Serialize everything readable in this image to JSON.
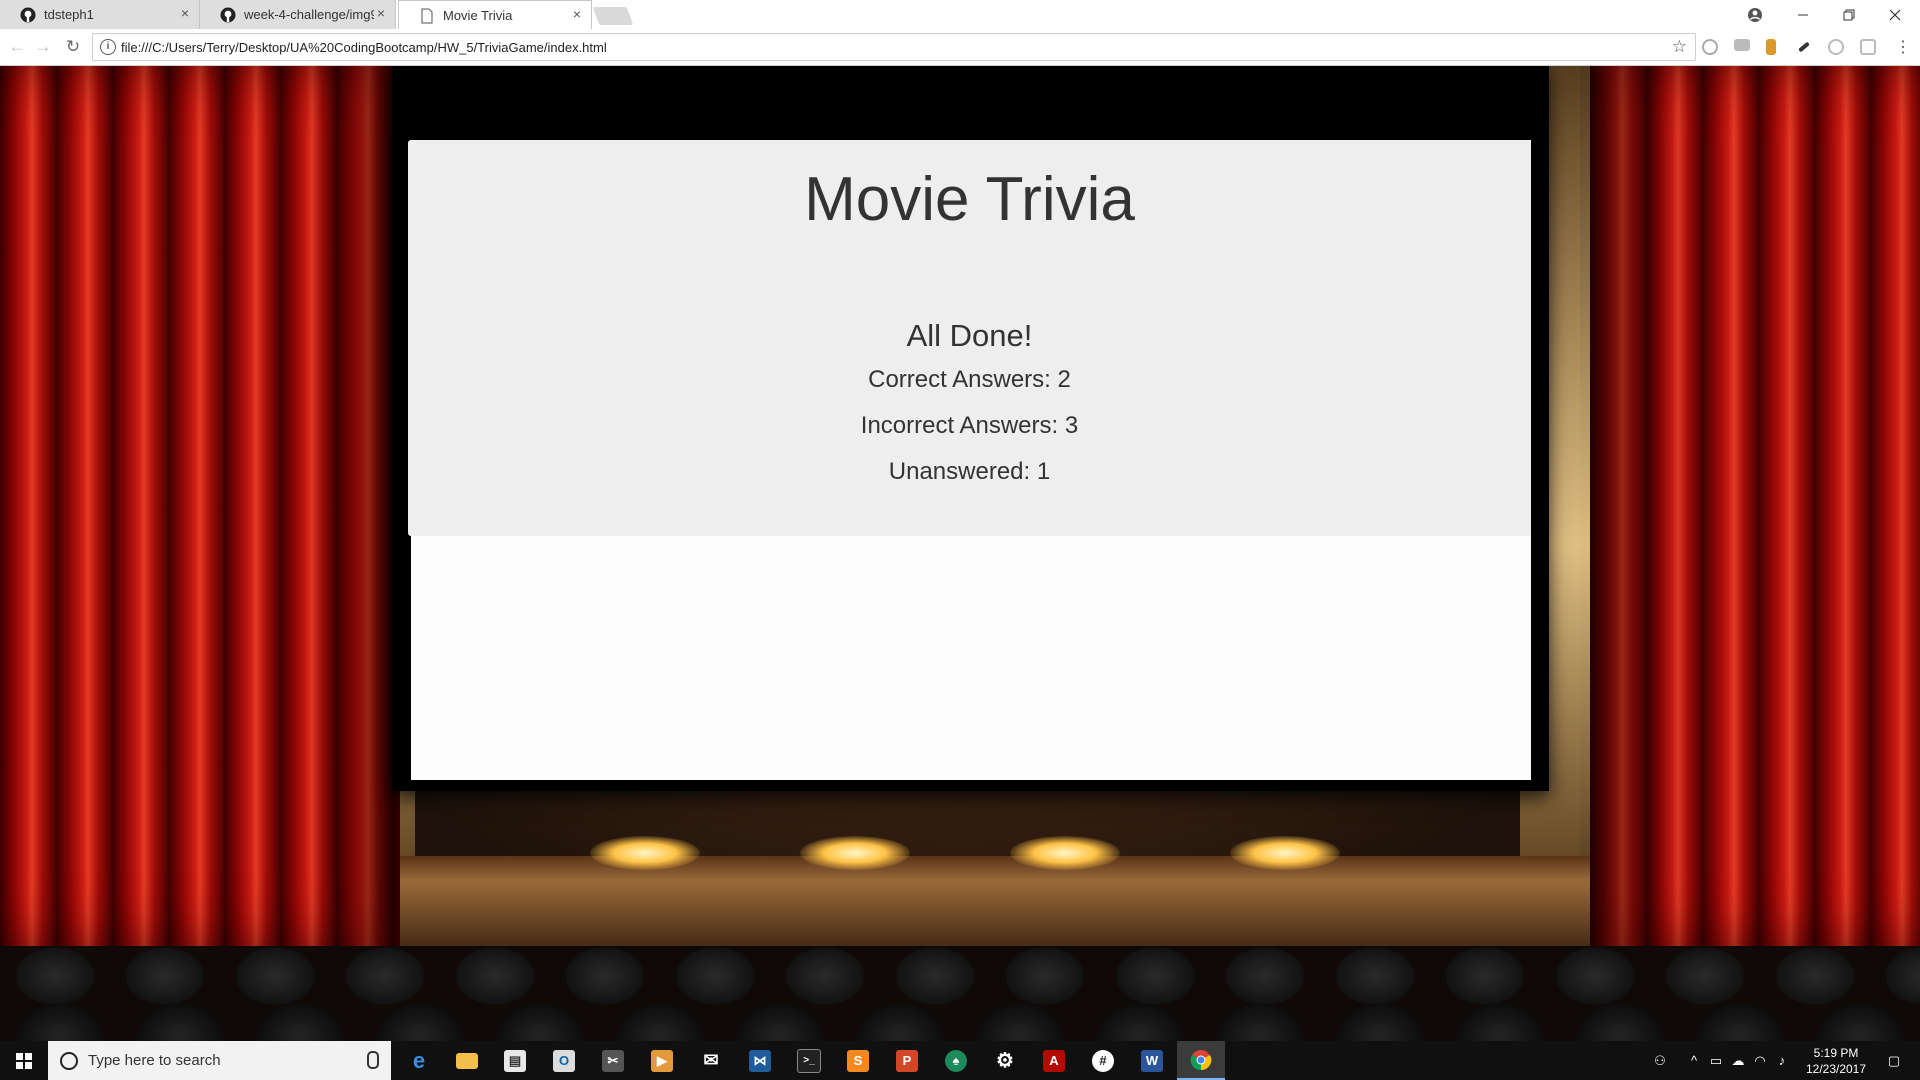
{
  "browser": {
    "tabs": [
      {
        "label": "tdsteph1",
        "close": "×"
      },
      {
        "label": "week-4-challenge/img9.j",
        "close": "×"
      },
      {
        "label": "Movie Trivia",
        "close": "×"
      }
    ],
    "url": "file:///C:/Users/Terry/Desktop/UA%20CodingBootcamp/HW_5/TriviaGame/index.html",
    "info_icon": "i"
  },
  "page": {
    "title": "Movie Trivia",
    "done_heading": "All Done!",
    "correct": "Correct Answers: 2",
    "incorrect": "Incorrect Answers: 3",
    "unanswered": "Unanswered: 1"
  },
  "taskbar": {
    "search_placeholder": "Type here to search",
    "apps": [
      "edge-icon",
      "file-explorer-icon",
      "store-icon",
      "outlook-icon",
      "snip-icon",
      "video-icon",
      "mail-icon",
      "visual-studio-icon",
      "terminal-icon",
      "sublime-icon",
      "powerpoint-icon",
      "gitkraken-icon",
      "settings-icon",
      "acrobat-icon",
      "slack-icon",
      "word-icon",
      "chrome-icon"
    ],
    "time": "5:19 PM",
    "date": "12/23/2017"
  },
  "colors": {
    "panel_bg": "#eeeeee",
    "text": "#333333",
    "curtain_red": "#c81a12",
    "taskbar": "#101010"
  }
}
